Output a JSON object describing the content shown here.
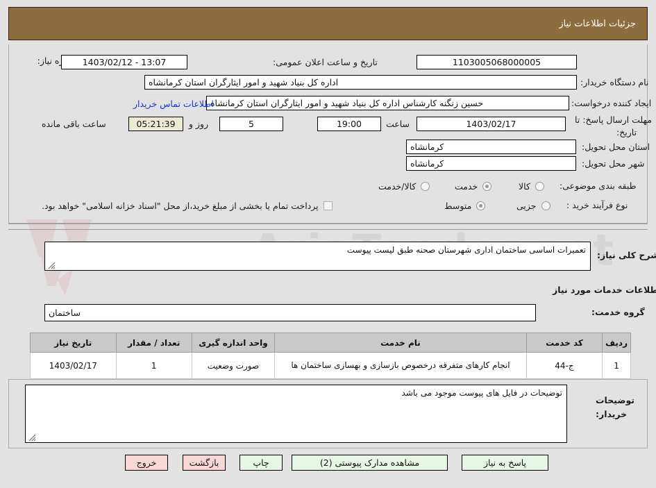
{
  "header": {
    "title": "جزئیات اطلاعات نیاز"
  },
  "watermark": {
    "text": "AriaTender.net"
  },
  "form": {
    "need_number": {
      "label": "شماره نیاز:",
      "value": "1103005068000005"
    },
    "announce_datetime": {
      "label": "تاریخ و ساعت اعلان عمومی:",
      "value": "13:07 - 1403/02/12"
    },
    "buyer_org": {
      "label": "نام دستگاه خریدار:",
      "value": "اداره کل بنیاد شهید و امور ایثارگران استان کرمانشاه"
    },
    "request_creator": {
      "label": "ایجاد کننده درخواست:",
      "value": "حسین زنگنه کارشناس اداره کل بنیاد شهید و امور ایثارگران استان کرمانشاه"
    },
    "buyer_contact_link": "اطلاعات تماس خریدار",
    "deadline": {
      "label_line1": "مهلت ارسال پاسخ: تا",
      "label_line2": "تاریخ:",
      "date": "1403/02/17",
      "time_label": "ساعت",
      "time": "19:00",
      "days": "5",
      "days_label": "روز و",
      "countdown": "05:21:39",
      "remaining_label": "ساعت باقی مانده"
    },
    "delivery_province": {
      "label": "استان محل تحویل:",
      "value": "کرمانشاه"
    },
    "delivery_city": {
      "label": "شهر محل تحویل:",
      "value": "کرمانشاه"
    },
    "subject_category": {
      "label": "طبقه بندی موضوعی:",
      "options": [
        "کالا",
        "خدمت",
        "کالا/خدمت"
      ],
      "selected": "خدمت"
    },
    "purchase_process": {
      "label": "نوع فرآیند خرید :",
      "options": [
        "جزیی",
        "متوسط"
      ],
      "selected": "متوسط"
    },
    "treasury_note": {
      "text": "پرداخت تمام یا بخشی از مبلغ خرید،از محل \"اسناد خزانه اسلامی\" خواهد بود.",
      "checked": false
    }
  },
  "need_description": {
    "label": "شرح کلی نیاز:",
    "value": "تعمیرات اساسی ساختمان اداری شهرستان صحنه طبق لیست پیوست"
  },
  "services_section": {
    "heading": "اطلاعات خدمات مورد نیاز",
    "service_group": {
      "label": "گروه خدمت:",
      "value": "ساختمان"
    }
  },
  "items_table": {
    "columns": [
      "ردیف",
      "کد خدمت",
      "نام خدمت",
      "واحد اندازه گیری",
      "تعداد / مقدار",
      "تاریخ نیاز"
    ],
    "rows": [
      {
        "index": "1",
        "code": "ج-44",
        "name": "انجام کارهای متفرقه درخصوص بازسازی و بهسازی ساختمان ها",
        "unit": "صورت وضعیت",
        "quantity": "1",
        "need_date": "1403/02/17"
      }
    ]
  },
  "buyer_notes": {
    "label_line1": "توضیحات",
    "label_line2": "خریدار:",
    "value": "توضیحات در فایل های پیوست موجود می باشد"
  },
  "buttons": {
    "respond": "پاسخ به نیاز",
    "view_docs": "مشاهده مدارک پیوستی (2)",
    "print": "چاپ",
    "back": "بازگشت",
    "exit": "خروج"
  }
}
